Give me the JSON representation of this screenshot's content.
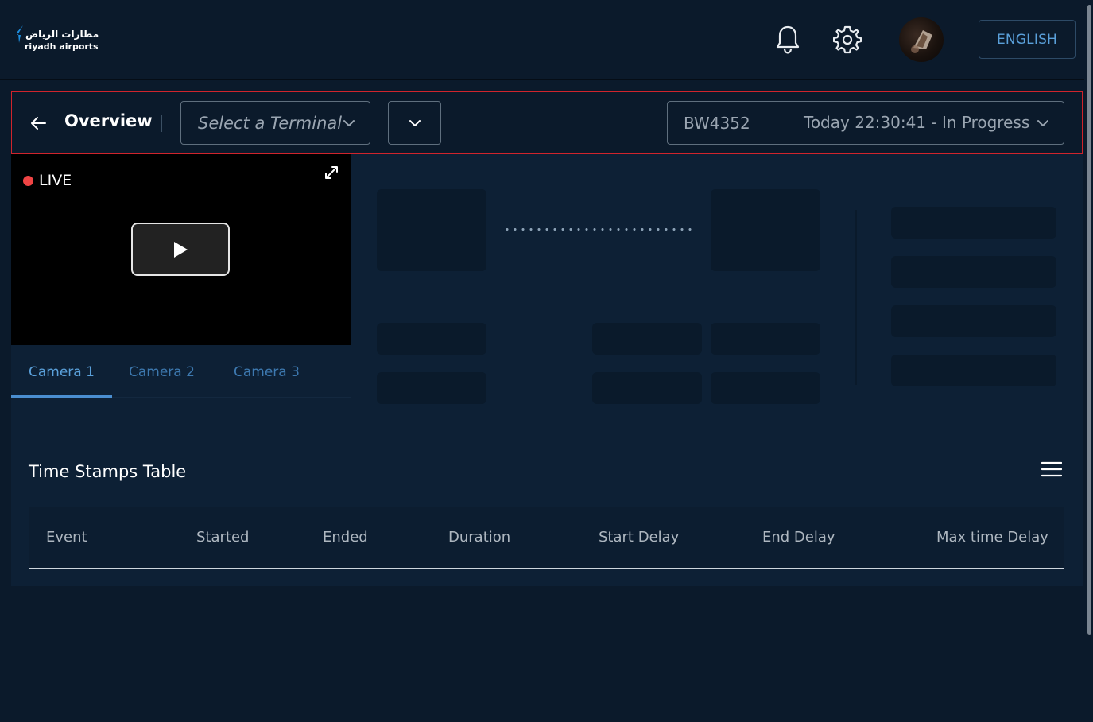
{
  "header": {
    "logo_arabic": "مطارات الرياض",
    "logo_english": "riyadh airports",
    "language_button": "ENGLISH"
  },
  "toolbar": {
    "title": "Overview",
    "terminal_placeholder": "Select a Terminal",
    "flight_code": "BW4352",
    "flight_status": "Today 22:30:41 - In Progress"
  },
  "video": {
    "live_label": "LIVE"
  },
  "camera_tabs": [
    {
      "label": "Camera 1",
      "active": true
    },
    {
      "label": "Camera 2",
      "active": false
    },
    {
      "label": "Camera 3",
      "active": false
    }
  ],
  "timestamps_table": {
    "title": "Time Stamps Table",
    "columns": [
      "Event",
      "Started",
      "Ended",
      "Duration",
      "Start Delay",
      "End Delay",
      "Max time Delay"
    ]
  },
  "icons": {
    "brand": "logo-mark-icon",
    "notifications": "bell-icon",
    "settings": "gear-icon",
    "back": "arrow-left-icon",
    "dropdown": "chevron-down-icon",
    "fullscreen": "expand-icon",
    "play": "play-icon",
    "table_menu": "hamburger-menu-icon"
  },
  "colors": {
    "background": "#0b1a2b",
    "panel": "#0d2035",
    "accent": "#5aa0da",
    "highlight_border": "#d0242c",
    "live_dot": "#ef4444"
  }
}
